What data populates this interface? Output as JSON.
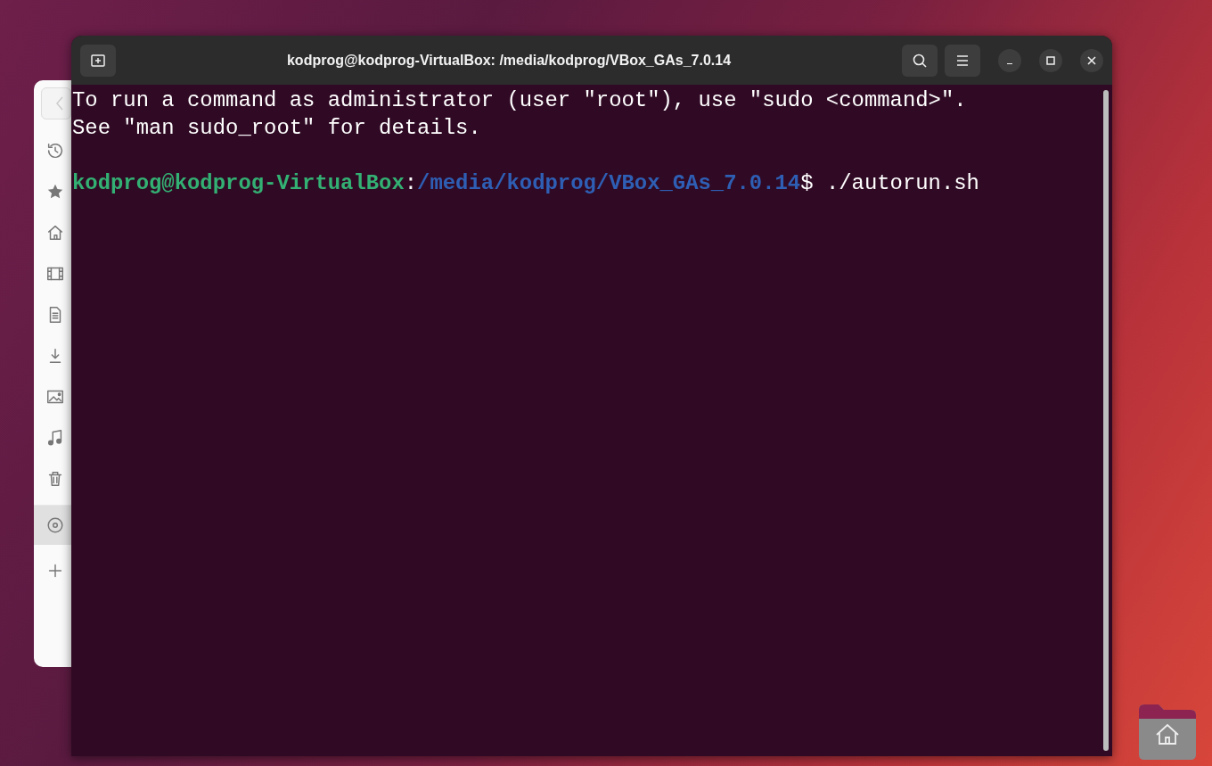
{
  "window": {
    "title": "kodprog@kodprog-VirtualBox: /media/kodprog/VBox_GAs_7.0.14"
  },
  "sidebar": {
    "items": [
      {
        "kind": "recent",
        "selected": false
      },
      {
        "kind": "starred",
        "selected": false
      },
      {
        "kind": "home",
        "selected": false
      },
      {
        "kind": "videos",
        "selected": false
      },
      {
        "kind": "documents",
        "selected": false
      },
      {
        "kind": "downloads",
        "selected": false
      },
      {
        "kind": "pictures",
        "selected": false
      },
      {
        "kind": "music",
        "selected": false
      },
      {
        "kind": "trash",
        "selected": false
      },
      {
        "kind": "disc",
        "selected": true
      },
      {
        "kind": "add",
        "selected": false
      }
    ]
  },
  "terminal": {
    "lines": [
      {
        "kind": "text",
        "text": "To run a command as administrator (user \"root\"), use \"sudo <command>\"."
      },
      {
        "kind": "text",
        "text": "See \"man sudo_root\" for details."
      },
      {
        "kind": "blank"
      },
      {
        "kind": "prompt",
        "user_host": "kodprog@kodprog-VirtualBox",
        "separator": ":",
        "path": "/media/kodprog/VBox_GAs_7.0.14",
        "symbol": "$",
        "command": " ./autorun.sh"
      }
    ]
  }
}
